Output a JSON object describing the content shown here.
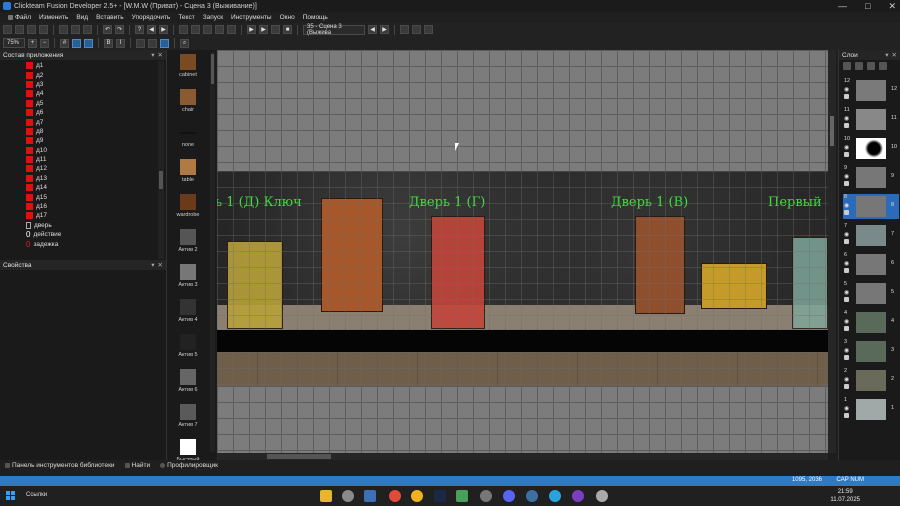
{
  "titlebar": {
    "title": "Clickteam Fusion Developer 2.5+ - [W.M.W (Приват) - Сцена 3 (Выживание)]",
    "controls": [
      "—",
      "□",
      "✕"
    ]
  },
  "menu": [
    "Файл",
    "Изменить",
    "Вид",
    "Вставить",
    "Упорядочить",
    "Текст",
    "Запуск",
    "Инструменты",
    "Окно",
    "Помощь"
  ],
  "toolbar": {
    "zoom": "75%",
    "frame_select": "35 - Сцена 3 (Выжива"
  },
  "app_tree": {
    "header": "Состав приложения",
    "items": [
      {
        "label": "д1",
        "kind": "red"
      },
      {
        "label": "д2",
        "kind": "red"
      },
      {
        "label": "д3",
        "kind": "red"
      },
      {
        "label": "д4",
        "kind": "red"
      },
      {
        "label": "д5",
        "kind": "red"
      },
      {
        "label": "д6",
        "kind": "red"
      },
      {
        "label": "д7",
        "kind": "red"
      },
      {
        "label": "д8",
        "kind": "red"
      },
      {
        "label": "д9",
        "kind": "red"
      },
      {
        "label": "д10",
        "kind": "red"
      },
      {
        "label": "д11",
        "kind": "red"
      },
      {
        "label": "д12",
        "kind": "red"
      },
      {
        "label": "д13",
        "kind": "red"
      },
      {
        "label": "д14",
        "kind": "red"
      },
      {
        "label": "д15",
        "kind": "red"
      },
      {
        "label": "д16",
        "kind": "red"
      },
      {
        "label": "д17",
        "kind": "red"
      },
      {
        "label": "дверь",
        "kind": "door"
      },
      {
        "label": "действие",
        "kind": "zero"
      },
      {
        "label": "задежка",
        "kind": "zero-red"
      }
    ]
  },
  "properties": {
    "header": "Свойства"
  },
  "object_library": [
    {
      "label": "cabinet"
    },
    {
      "label": "chair"
    },
    {
      "label": "none"
    },
    {
      "label": "table"
    },
    {
      "label": "wardrobe"
    },
    {
      "label": "Актив 2"
    },
    {
      "label": "Актив 3"
    },
    {
      "label": "Актив 4"
    },
    {
      "label": "Актив 5"
    },
    {
      "label": "Актив 6"
    },
    {
      "label": "Актив 7"
    },
    {
      "label": "Быстрый"
    }
  ],
  "scene": {
    "labels": [
      "ь 1 (Д) Ключ",
      "Дверь 1 (Г)",
      "Дверь 1 (В)",
      "Первый"
    ]
  },
  "layers": {
    "header": "Слои",
    "items": [
      {
        "num": "12",
        "right": "12"
      },
      {
        "num": "11",
        "right": "11"
      },
      {
        "num": "10",
        "right": "10"
      },
      {
        "num": "9",
        "right": "9"
      },
      {
        "num": "8",
        "right": "8",
        "selected": true
      },
      {
        "num": "7",
        "right": "7"
      },
      {
        "num": "6",
        "right": "6"
      },
      {
        "num": "5",
        "right": "5"
      },
      {
        "num": "4",
        "right": "4"
      },
      {
        "num": "3",
        "right": "3"
      },
      {
        "num": "2",
        "right": "2"
      },
      {
        "num": "1",
        "right": "1"
      }
    ]
  },
  "bottom_tabs": [
    "Панель инструментов библиотеки",
    "Найти",
    "Профилировщик"
  ],
  "status": {
    "coords": "1095, 2036",
    "mode": "CAP NUM"
  },
  "taskbar": {
    "links_label": "Ссылки",
    "time": "21:59",
    "date": "11.07.2025"
  }
}
